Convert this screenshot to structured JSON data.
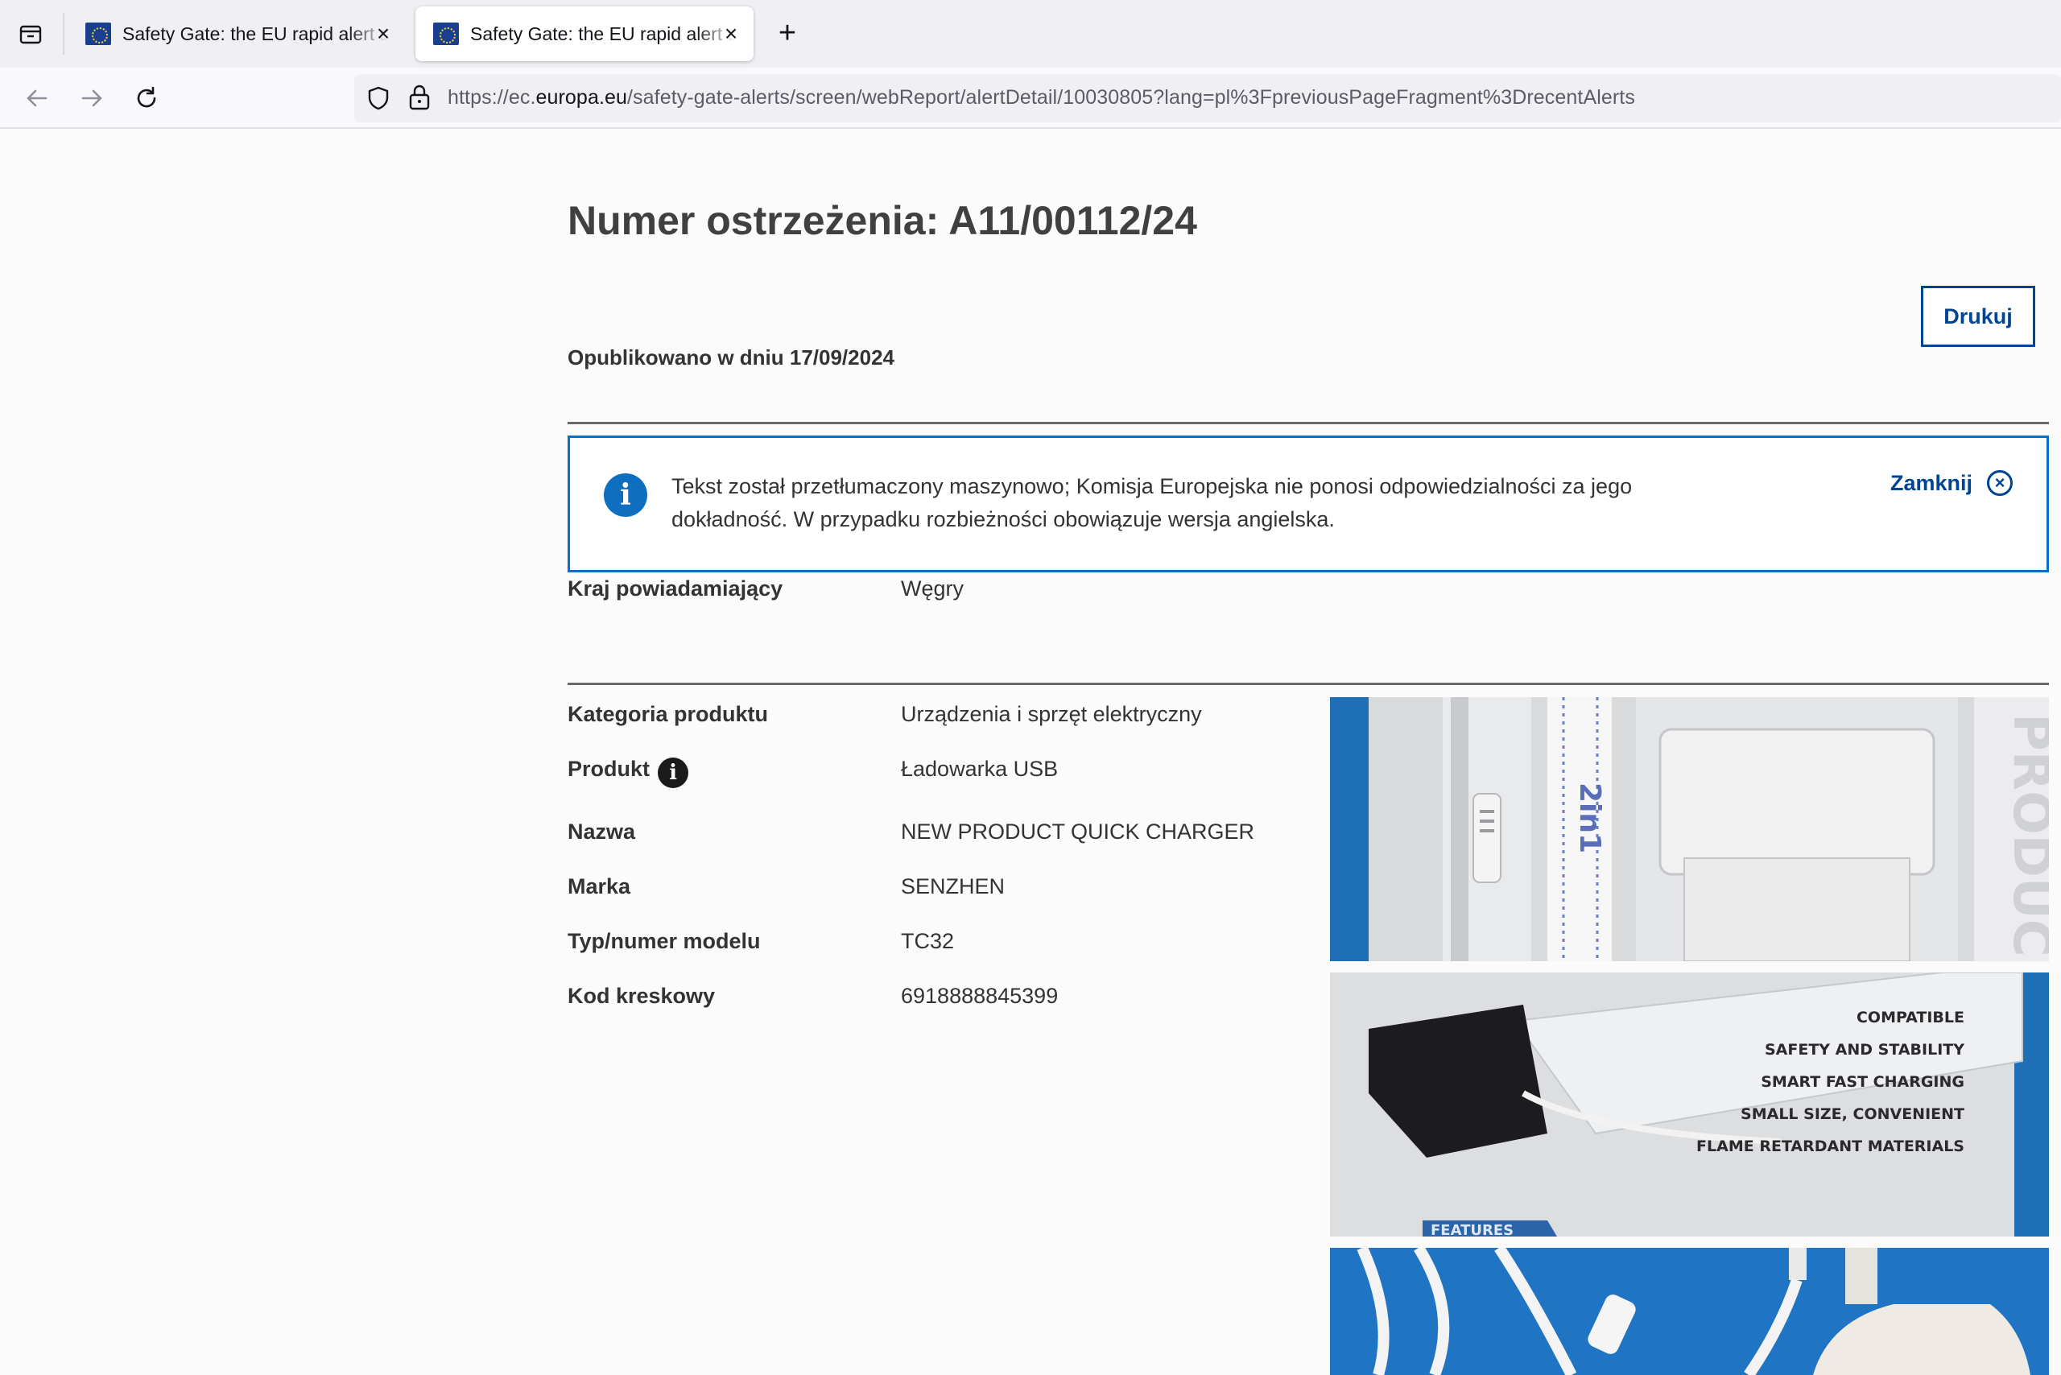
{
  "browser": {
    "tabs": [
      {
        "title": "Safety Gate: the EU rapid alert system for dangerous non-food products",
        "active": false
      },
      {
        "title": "Safety Gate: the EU rapid alert system for dangerous non-food products",
        "active": true
      }
    ],
    "url": {
      "prefix": "https://ec.",
      "host": "europa.eu",
      "path": "/safety-gate-alerts/screen/webReport/alertDetail/10030805?lang=pl%3FpreviousPageFragment%3DrecentAlerts"
    }
  },
  "page": {
    "title": "Numer ostrzeżenia: A11/00112/24",
    "print_label": "Drukuj",
    "published": "Opublikowano w dniu 17/09/2024",
    "notice": {
      "text": "Tekst został przetłumaczony maszynowo; Komisja Europejska nie ponosi odpowiedzialności za jego dokładność. W przypadku rozbieżności obowiązuje wersja angielska.",
      "close_label": "Zamknij"
    },
    "country": {
      "label": "Kraj powiadamiający",
      "value": "Węgry"
    },
    "details": [
      {
        "label": "Kategoria produktu",
        "value": "Urządzenia i sprzęt elektryczny"
      },
      {
        "label": "Produkt",
        "value": "Ładowarka USB"
      },
      {
        "label": "Nazwa",
        "value": "NEW PRODUCT QUICK CHARGER"
      },
      {
        "label": "Marka",
        "value": "SENZHEN"
      },
      {
        "label": "Typ/numer modelu",
        "value": "TC32"
      },
      {
        "label": "Kod kreskowy",
        "value": "6918888845399"
      }
    ],
    "photo_texts": {
      "box_label": "2in1",
      "features": [
        "COMPATIBLE",
        "SAFETY AND STABILITY",
        "SMART FAST CHARGING",
        "SMALL SIZE, CONVENIENT",
        "FLAME RETARDANT MATERIALS"
      ],
      "features_tag": "FEATURES"
    }
  },
  "colors": {
    "accent": "#004494",
    "info": "#0e6fc1",
    "photo_blue": "#1f6fb7"
  }
}
